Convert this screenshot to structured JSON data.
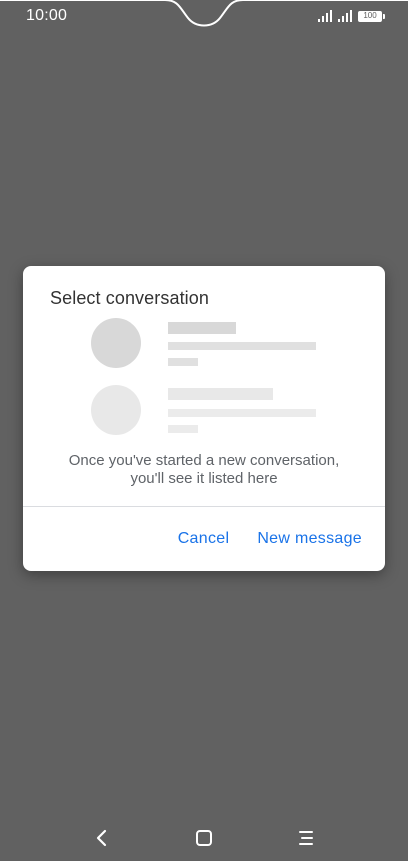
{
  "status_bar": {
    "time": "10:00",
    "battery_level": "100",
    "signal_icons": [
      "signal-icon",
      "signal-icon"
    ]
  },
  "dialog": {
    "title": "Select conversation",
    "empty_message": "Once you've started a new conversation, you'll see it listed here",
    "cancel_label": "Cancel",
    "new_message_label": "New message"
  },
  "nav_bar": {
    "icons": [
      "back-icon",
      "home-icon",
      "menu-icon"
    ]
  },
  "colors": {
    "scrim": "#616161",
    "accent": "#1a73e8",
    "placeholder_dark": "#d8d8d8",
    "placeholder_light": "#e8e8e8"
  }
}
